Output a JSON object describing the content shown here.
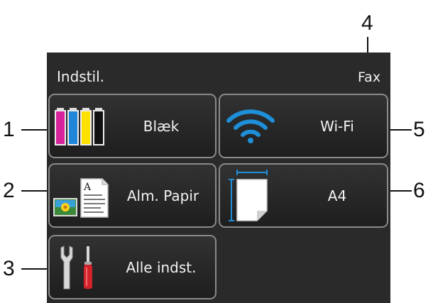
{
  "header": {
    "title": "Indstil.",
    "mode": "Fax"
  },
  "buttons": [
    {
      "label": "Blæk",
      "icon": "ink-cartridges-icon"
    },
    {
      "label": "Wi-Fi",
      "icon": "wifi-icon"
    },
    {
      "label": "Alm. Papir",
      "icon": "paper-type-icon"
    },
    {
      "label": "A4",
      "icon": "paper-size-icon"
    },
    {
      "label": "Alle indst.",
      "icon": "tools-icon"
    }
  ],
  "callouts": [
    "1",
    "2",
    "3",
    "4",
    "5",
    "6"
  ],
  "colors": {
    "screen": "#2a2a2a",
    "button_border": "#8a8a8a",
    "wifi": "#1e8fd8",
    "ink_magenta": "#d6239c",
    "ink_cyan": "#1f86d9",
    "ink_yellow": "#ffe100",
    "ink_black": "#111111"
  }
}
